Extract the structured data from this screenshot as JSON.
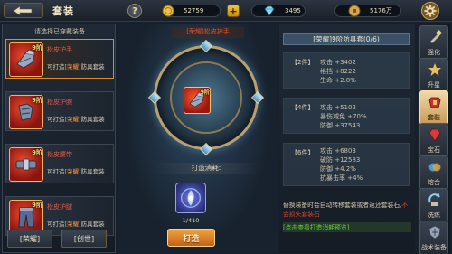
{
  "header": {
    "title": "套装",
    "resources": [
      {
        "icon": "gold-coin-icon",
        "value": "52759"
      },
      {
        "icon": "diamond-icon",
        "value": "3495"
      },
      {
        "icon": "silver-coin-icon",
        "value": "5176万"
      }
    ]
  },
  "left": {
    "hint": "请选择已穿戴装备",
    "items": [
      {
        "tier": "9阶",
        "name": "松皮护手",
        "sub_prefix": "可打造",
        "sub_set": "[荣耀]",
        "sub_suffix": "防具套装"
      },
      {
        "tier": "9阶",
        "name": "松皮护腕",
        "sub_prefix": "可打造",
        "sub_set": "[荣耀]",
        "sub_suffix": "防具套装"
      },
      {
        "tier": "9阶",
        "name": "松皮腰带",
        "sub_prefix": "可打造",
        "sub_set": "[荣耀]",
        "sub_suffix": "防具套装"
      },
      {
        "tier": "9阶",
        "name": "松皮护腿",
        "sub_prefix": "可打造",
        "sub_set": "[荣耀]",
        "sub_suffix": "防具套装"
      }
    ],
    "filters": [
      "[荣耀]",
      "[创世]"
    ]
  },
  "center": {
    "header": "[荣耀]松皮护手",
    "item_tier": "9阶",
    "cost_label": "打造消耗:",
    "cost_count": "1/410",
    "forge_button": "打造"
  },
  "info": {
    "set_title": "[荣耀]9阶防具套(0/6)",
    "bonuses": [
      {
        "tag": "【2件】",
        "lines": [
          "攻击 +3402",
          "格挡 +8222",
          "生命 +2.8%"
        ]
      },
      {
        "tag": "【4件】",
        "lines": [
          "攻击 +5102",
          "暴伤减免 +70%",
          "防御 +37543"
        ]
      },
      {
        "tag": "【6件】",
        "lines": [
          "攻击 +6803",
          "破防 +12583",
          "防御 +4.2%",
          "抗暴击率 +4%"
        ]
      }
    ],
    "note_main": "替换装备时会自动转移套装或者返还套装石,",
    "note_warn": "不会损失套装石",
    "link": "[点击查看打造消耗预览]"
  },
  "sidebar": {
    "tabs": [
      {
        "label": "强化",
        "icon": "strengthen-icon",
        "active": false
      },
      {
        "label": "升星",
        "icon": "star-upgrade-icon",
        "active": false
      },
      {
        "label": "套装",
        "icon": "suit-icon",
        "active": true
      },
      {
        "label": "宝石",
        "icon": "gem-icon",
        "active": false
      },
      {
        "label": "熔合",
        "icon": "fusion-icon",
        "active": false
      },
      {
        "label": "洗练",
        "icon": "refine-icon",
        "active": false
      },
      {
        "label": "战术装备",
        "icon": "tactical-gear-icon",
        "active": false
      }
    ]
  },
  "colors": {
    "accent_orange": "#f2a23a",
    "warn_red": "#e0402e",
    "link_green": "#6ad43a",
    "active_tab": "#f0d8a8"
  }
}
